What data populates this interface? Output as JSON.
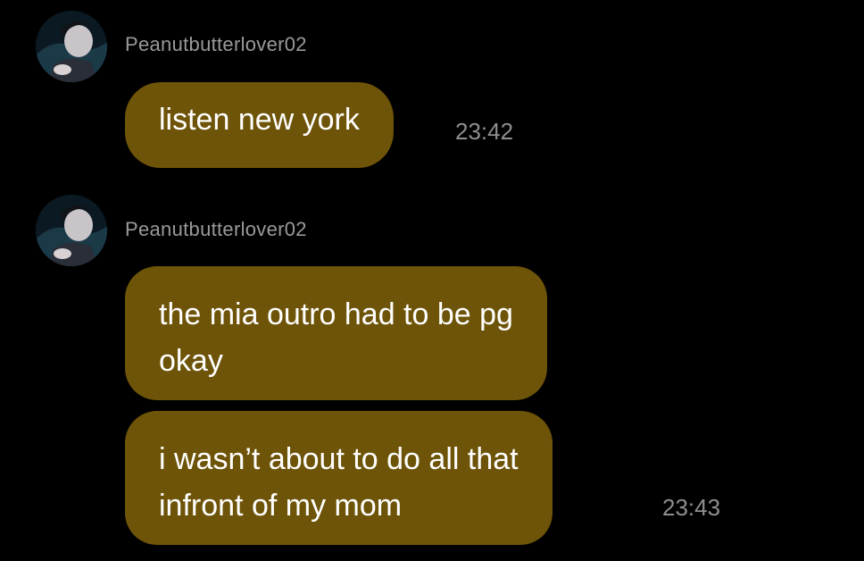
{
  "conversation": {
    "groups": [
      {
        "username": "Peanutbutterlover02",
        "avatar_icon": "profile-photo-avatar",
        "messages": [
          {
            "lines": [
              "listen new york"
            ],
            "time": "23:42"
          }
        ]
      },
      {
        "username": "Peanutbutterlover02",
        "avatar_icon": "profile-photo-avatar",
        "messages": [
          {
            "lines": [
              "the mia outro had to be pg",
              "okay"
            ],
            "time": ""
          },
          {
            "lines": [
              "i wasn’t about to do all that",
              "infront of my mom"
            ],
            "time": "23:43"
          }
        ]
      }
    ]
  },
  "colors": {
    "background": "#000000",
    "bubble": "#6e5408",
    "username": "#9a9a9a",
    "timestamp": "#8e8e8e"
  }
}
